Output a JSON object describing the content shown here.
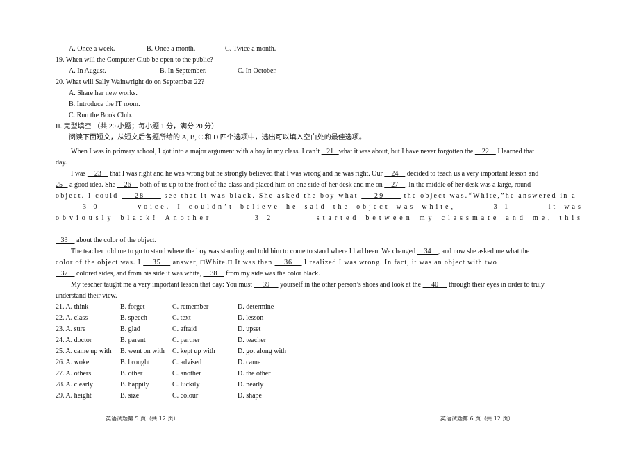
{
  "listening": {
    "q18_options": [
      "A. Once a week.",
      "B. Once a month.",
      "C. Twice a month."
    ],
    "q19": {
      "question": "19. When will the Computer Club be open to the public?",
      "options": [
        "A. In August.",
        "B. In September.",
        "C. In October."
      ]
    },
    "q20": {
      "question": "20. What will Sally Wainwright do on September 22?",
      "options": [
        "A. Share her new works.",
        "B. Introduce the IT room.",
        "C. Run the Book Club."
      ]
    }
  },
  "section2": {
    "heading": "II. 完型填空 （共 20 小题；每小题 1 分，满分 20 分）",
    "instructions": "阅读下面短文，从短文后各题所给的 A, B, C 和 D 四个选项中，选出可以填入空白处的最佳选项。"
  },
  "passage": {
    "p1_a": "When I was in primary school, I got into a major argument with a boy in my class. I can’t ",
    "b21": "   21   ",
    "p1_b": "what it was about, but I have never forgotten the ",
    "b22": "    22    ",
    "p1_c": " I learned that",
    "p1_d": "day.",
    "p2_a": "I was ",
    "b23": "    23    ",
    "p2_b": " that I was right and he was wrong but he strongly believed that I was wrong and he was right. Our ",
    "b24": "    24    ",
    "p2_c": " decided to teach us a very important lesson and",
    "b25": "25   ",
    "p2_d": " a good idea. She ",
    "b26": "    26    ",
    "p2_e": " both of us up to the front of the class and placed him on one side of her desk and me on ",
    "b27": "    27    ",
    "p2_f": ". In the middle of her desk was a large, round",
    "p2_g": "object. I could ",
    "b28": "    28     ",
    "p2_h": " see that it was black. She asked the boy what ",
    "b29": "    29     ",
    "p2_i": " the object was.“White,”he answered in a",
    "line_30_31": [
      "voice.",
      "I",
      "couldn’t",
      "believe",
      "he",
      "said",
      "the",
      "object",
      "was",
      "white,",
      "it",
      "was"
    ],
    "b30": "      3 0       ",
    "b31": "       3 1       ",
    "line_32": [
      "obviously",
      "black!",
      "Another",
      "started",
      "between",
      "my",
      "classmate",
      "and",
      "me,",
      "this"
    ],
    "b32": "       3 2       ",
    "b33": "   33    ",
    "p2_j": " about the color of the object.",
    "p3_a": "The teacher told me to go to stand where the boy was standing and told him to come to stand where I had been. We changed ",
    "b34": "    34    ",
    "p3_b": ", and now she asked me what the",
    "p3_c": "color of the object was. I ",
    "b35": "    35    ",
    "p3_d": " answer, □White.□ It was then ",
    "b36": "    36    ",
    "p3_e": " I realized I was wrong. In fact, it was an object with two",
    "b37": "   37    ",
    "p3_f": " colored sides, and from his side it was white, ",
    "b38": "    38    ",
    "p3_g": " from my side was the color black.",
    "p4_a": "My teacher taught me a very important lesson that day: You must ",
    "b39": "     39     ",
    "p4_b": " yourself in the other person’s shoes and look at the ",
    "b40": "     40     ",
    "p4_c": " through their eyes in order to truly",
    "p4_d": "understand their view."
  },
  "options": [
    [
      "21. A. think",
      "B. forget",
      "C. remember",
      "D. determine"
    ],
    [
      "22. A. class",
      "B. speech",
      "C. text",
      "D. lesson"
    ],
    [
      "23. A. sure",
      "B. glad",
      "C. afraid",
      "D. upset"
    ],
    [
      "24. A. doctor",
      "B. parent",
      "C. partner",
      "D. teacher"
    ],
    [
      "25. A. came up with",
      "B. went on with",
      "C. kept up with",
      "D. got along with"
    ],
    [
      "26. A. woke",
      "B. brought",
      "C. advised",
      "D. came"
    ],
    [
      "27. A. others",
      "B. other",
      "C. another",
      "D. the other"
    ],
    [
      "28. A. clearly",
      "B. happily",
      "C. luckily",
      "D. nearly"
    ],
    [
      "29. A. height",
      "B. size",
      "C. colour",
      "D. shape"
    ]
  ],
  "footer": {
    "left": "英语试题第 5 页（共 12 页）",
    "right": "英语试题第 6 页（共 12 页）"
  }
}
